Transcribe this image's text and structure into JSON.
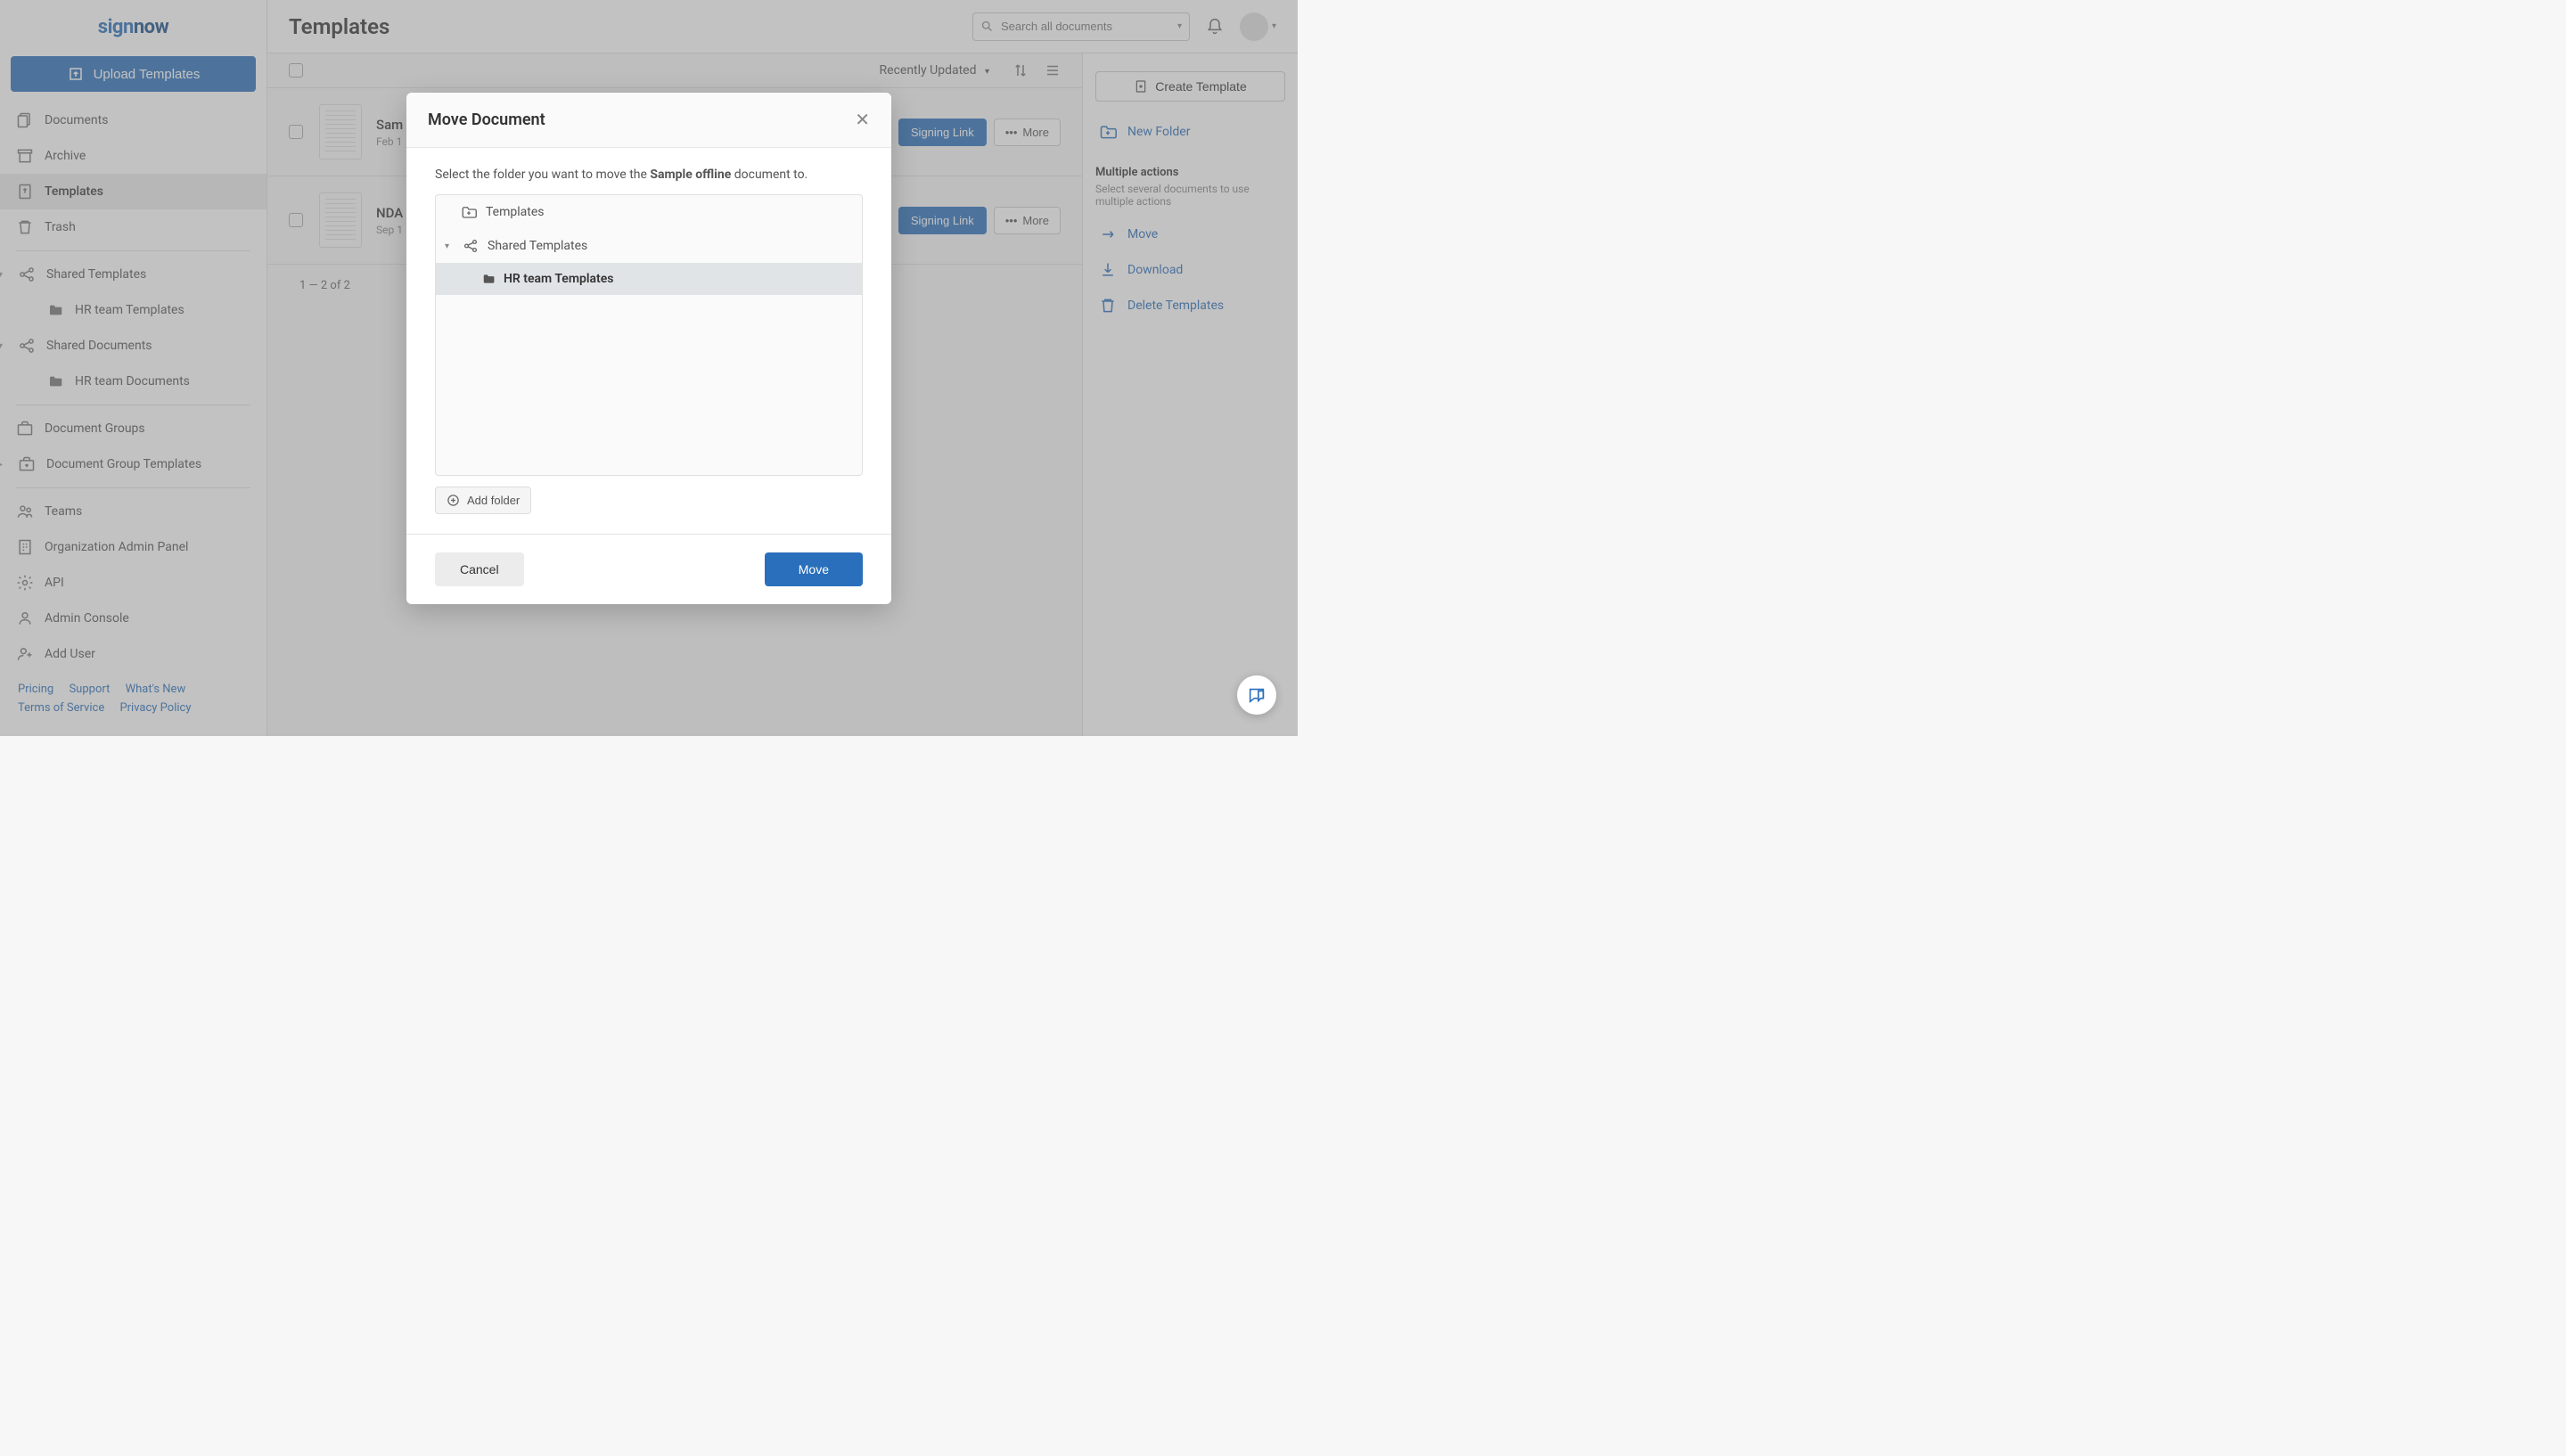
{
  "brand": {
    "part1": "sign",
    "part2": "now"
  },
  "upload_button": "Upload Templates",
  "nav": {
    "documents": "Documents",
    "archive": "Archive",
    "templates": "Templates",
    "trash": "Trash",
    "shared_templates": "Shared Templates",
    "hr_team_templates": "HR team Templates",
    "shared_documents": "Shared Documents",
    "hr_team_documents": "HR team Documents",
    "document_groups": "Document Groups",
    "document_group_templates": "Document Group Templates",
    "teams": "Teams",
    "org_admin": "Organization Admin Panel",
    "api": "API",
    "admin_console": "Admin Console",
    "add_user": "Add User"
  },
  "footer": {
    "pricing": "Pricing",
    "support": "Support",
    "whats_new": "What's New",
    "terms": "Terms of Service",
    "privacy": "Privacy Policy"
  },
  "page_title": "Templates",
  "search_placeholder": "Search all documents",
  "sort_label": "Recently Updated",
  "docs": [
    {
      "name": "Sam",
      "date": "Feb 1"
    },
    {
      "name": "NDA",
      "date": "Sep 1"
    }
  ],
  "signing_link": "Signing Link",
  "more": "More",
  "pager": "1 — 2 of 2",
  "right_panel": {
    "create_template": "Create Template",
    "new_folder": "New Folder",
    "multi_title": "Multiple actions",
    "multi_desc": "Select several documents to use multiple actions",
    "move": "Move",
    "download": "Download",
    "delete_templates": "Delete Templates"
  },
  "modal": {
    "title": "Move Document",
    "instruction_prefix": "Select the folder you want to move the ",
    "doc_name": "Sample offline",
    "instruction_suffix": " document to.",
    "tree": {
      "templates": "Templates",
      "shared_templates": "Shared Templates",
      "hr_team_templates": "HR team Templates"
    },
    "add_folder": "Add folder",
    "cancel": "Cancel",
    "move": "Move"
  }
}
